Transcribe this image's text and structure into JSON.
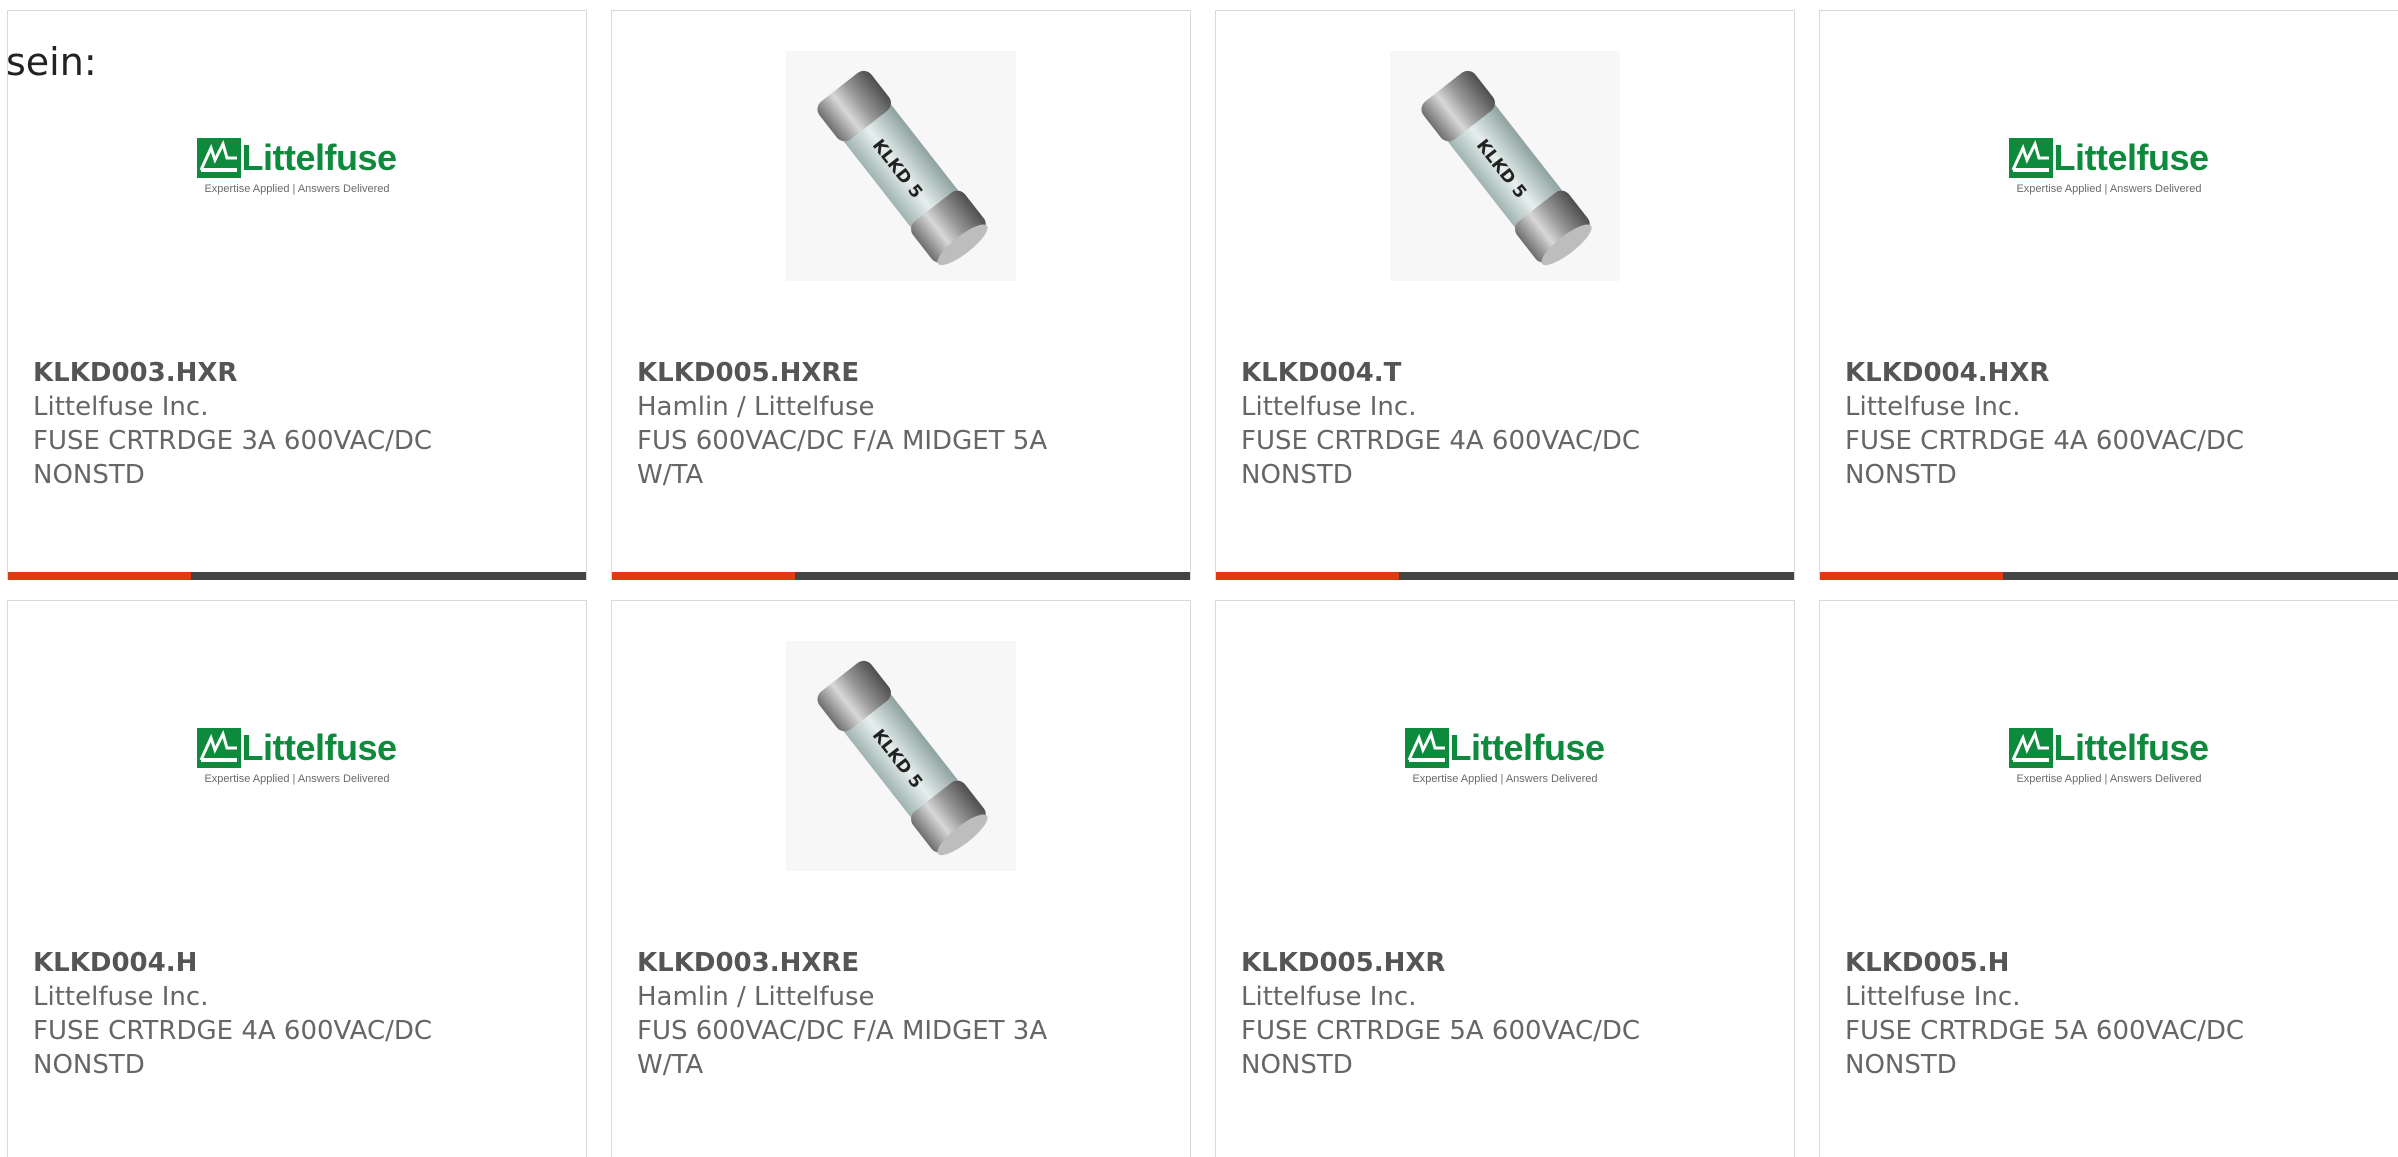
{
  "intro_text": "sein:",
  "colors": {
    "accent": "#e03a12",
    "bar": "#444444",
    "logo_green": "#0e8a3c"
  },
  "logo": {
    "wordmark": "Littelfuse",
    "tagline": "Expertise Applied | Answers Delivered"
  },
  "products": [
    {
      "part_number": "KLKD003.HXR",
      "manufacturer": "Littelfuse Inc.",
      "description": "FUSE CRTRDGE 3A 600VAC/DC NONSTD",
      "image": "littelfuse-logo",
      "fuse_label": ""
    },
    {
      "part_number": "KLKD005.HXRE",
      "manufacturer": "Hamlin / Littelfuse",
      "description": "FUS 600VAC/DC F/A MIDGET 5A W/TA",
      "image": "fuse-photo",
      "fuse_label": "KLKD 5"
    },
    {
      "part_number": "KLKD004.T",
      "manufacturer": "Littelfuse Inc.",
      "description": "FUSE CRTRDGE 4A 600VAC/DC NONSTD",
      "image": "fuse-photo",
      "fuse_label": "KLKD 5"
    },
    {
      "part_number": "KLKD004.HXR",
      "manufacturer": "Littelfuse Inc.",
      "description": "FUSE CRTRDGE 4A 600VAC/DC NONSTD",
      "image": "littelfuse-logo",
      "fuse_label": ""
    },
    {
      "part_number": "KLKD004.H",
      "manufacturer": "Littelfuse Inc.",
      "description": "FUSE CRTRDGE 4A 600VAC/DC NONSTD",
      "image": "littelfuse-logo",
      "fuse_label": ""
    },
    {
      "part_number": "KLKD003.HXRE",
      "manufacturer": "Hamlin / Littelfuse",
      "description": "FUS 600VAC/DC F/A MIDGET 3A W/TA",
      "image": "fuse-photo",
      "fuse_label": "KLKD 5"
    },
    {
      "part_number": "KLKD005.HXR",
      "manufacturer": "Littelfuse Inc.",
      "description": "FUSE CRTRDGE 5A 600VAC/DC NONSTD",
      "image": "littelfuse-logo",
      "fuse_label": ""
    },
    {
      "part_number": "KLKD005.H",
      "manufacturer": "Littelfuse Inc.",
      "description": "FUSE CRTRDGE 5A 600VAC/DC NONSTD",
      "image": "littelfuse-logo",
      "fuse_label": ""
    }
  ]
}
